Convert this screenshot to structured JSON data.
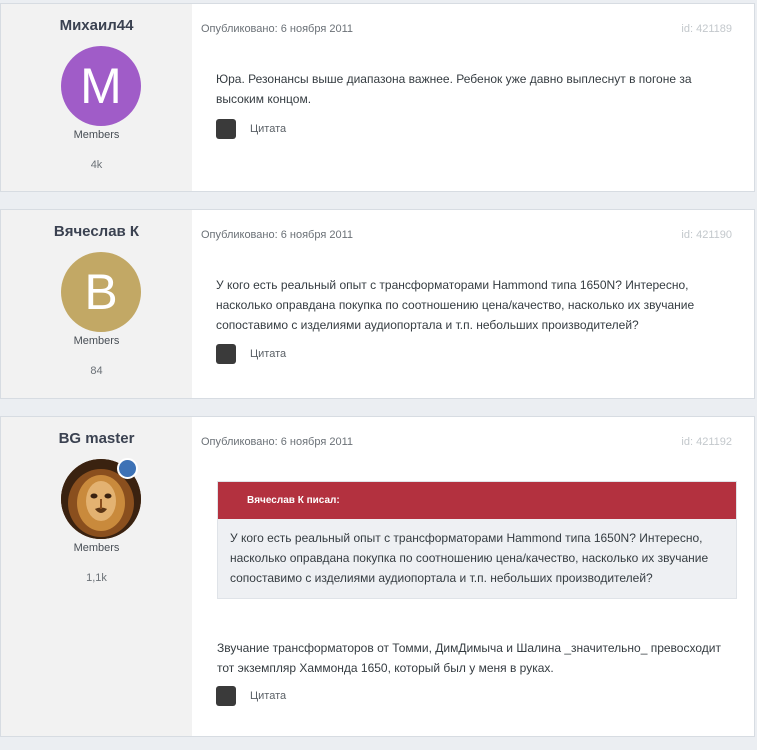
{
  "posts": [
    {
      "author": "Михаил44",
      "avatar_letter": "M",
      "group": "Members",
      "count": "4k",
      "published": "Опубликовано: 6 ноября 2011",
      "post_id": "id: 421189",
      "text": "Юра. Резонансы выше диапазона важнее. Ребенок уже давно выплеснут в погоне за высоким концом.",
      "quote_label": "Цитата"
    },
    {
      "author": "Вячеслав К",
      "avatar_letter": "B",
      "group": "Members",
      "count": "84",
      "published": "Опубликовано: 6 ноября 2011",
      "post_id": "id: 421190",
      "text": "У кого есть реальный опыт с трансформаторами Hammond типа 1650N? Интересно, насколько оправдана покупка по соотношению цена/качество, насколько их звучание сопоставимо с изделиями аудиопортала и т.п. небольших производителей?",
      "quote_label": "Цитата"
    },
    {
      "author": "BG master",
      "avatar_icon": "lion-avatar",
      "group": "Members",
      "count": "1,1k",
      "published": "Опубликовано: 6 ноября 2011",
      "post_id": "id: 421192",
      "quote": {
        "header": "Вячеслав К писал:",
        "text": "У кого есть реальный опыт с трансформаторами Hammond типа 1650N? Интересно, насколько оправдана покупка по соотношению цена/качество, насколько их звучание сопоставимо с изделиями аудиопортала и т.п. небольших производителей?"
      },
      "text": "Звучание трансформаторов от Томми, ДимДимыча и Шалина _значительно_ превосходит тот экземпляр Хаммонда 1650, который был у меня в руках.",
      "quote_label": "Цитата"
    }
  ],
  "colors": {
    "page_bg": "#ebeef2",
    "author_bg": "#f2f2f2",
    "quote_header": "#b3313f",
    "online_indicator": "#3d72b6"
  }
}
